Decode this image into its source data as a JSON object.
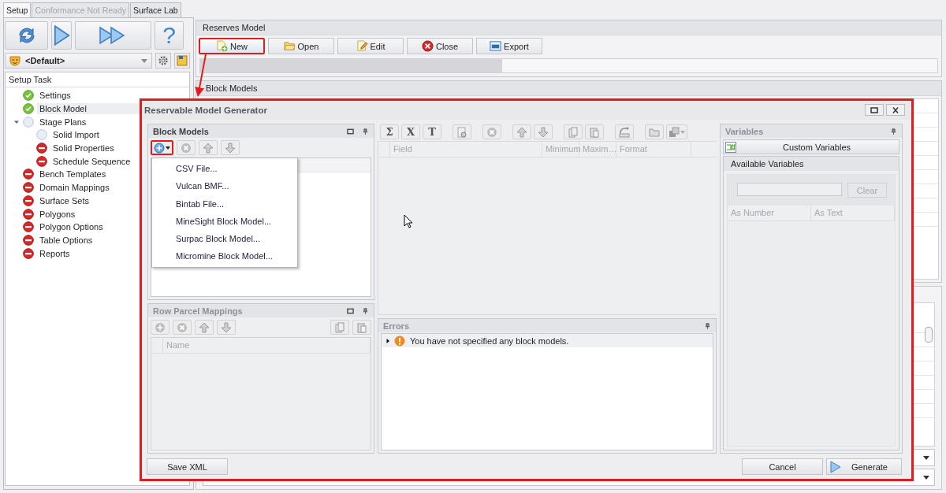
{
  "app_tabs": [
    {
      "label": "Setup",
      "selected": true,
      "disabled": false
    },
    {
      "label": "Conformance Not Ready",
      "selected": false,
      "disabled": true
    },
    {
      "label": "Surface Lab",
      "selected": false,
      "disabled": false
    }
  ],
  "profile": {
    "value": "<Default>"
  },
  "help_button": {
    "glyph": "?"
  },
  "setup_tree": {
    "header": "Setup Task",
    "items": [
      {
        "label": "Settings",
        "kind": "done",
        "selected": false
      },
      {
        "label": "Block Model",
        "kind": "done",
        "selected": true
      },
      {
        "label": "Stage Plans",
        "kind": "pending",
        "selected": false,
        "expanded": true,
        "children": [
          {
            "label": "Solid Import",
            "kind": "pending",
            "selected": false
          },
          {
            "label": "Solid Properties",
            "kind": "error",
            "selected": false
          },
          {
            "label": "Schedule Sequence",
            "kind": "error",
            "selected": false
          }
        ]
      },
      {
        "label": "Bench Templates",
        "kind": "error",
        "selected": false
      },
      {
        "label": "Domain Mappings",
        "kind": "error",
        "selected": false
      },
      {
        "label": "Surface Sets",
        "kind": "error",
        "selected": false
      },
      {
        "label": "Polygons",
        "kind": "error",
        "selected": false
      },
      {
        "label": "Polygon Options",
        "kind": "error",
        "selected": false
      },
      {
        "label": "Table Options",
        "kind": "error",
        "selected": false
      },
      {
        "label": "Reports",
        "kind": "error",
        "selected": false
      }
    ]
  },
  "reserves_model": {
    "title": "Reserves Model",
    "buttons": [
      {
        "kind": "new",
        "label": "New",
        "highlighted": true
      },
      {
        "kind": "open",
        "label": "Open",
        "highlighted": false
      },
      {
        "kind": "edit",
        "label": "Edit",
        "highlighted": false
      },
      {
        "kind": "close",
        "label": "Close",
        "highlighted": false
      },
      {
        "kind": "export",
        "label": "Export",
        "highlighted": false
      }
    ],
    "progress": {
      "level": 0.41
    }
  },
  "block_models_panel": {
    "title": "Block Models"
  },
  "dialog": {
    "title": "Reservable Model Generator",
    "highlighted": true,
    "block_models": {
      "title": "Block Models",
      "add_highlighted": true,
      "menu": [
        "CSV File...",
        "Vulcan BMF...",
        "Bintab File...",
        "MineSight Block Model...",
        "Surpac Block Model...",
        "Micromine Block Model..."
      ]
    },
    "row_parcel_mappings": {
      "title": "Row Parcel Mappings",
      "columns": [
        "Name"
      ]
    },
    "formula_buttons": [
      "Σ",
      "X",
      "T"
    ],
    "fields_grid": {
      "columns": [
        "Field",
        "Minimum",
        "Maxim…",
        "Format"
      ]
    },
    "errors": {
      "title": "Errors",
      "rows": [
        {
          "message": "You have not specified any block models.",
          "expanded": false
        }
      ]
    },
    "variables": {
      "title": "Variables",
      "custom_button": "Custom Variables",
      "available_title": "Available Variables",
      "clear_button": "Clear",
      "columns": [
        "As Number",
        "As Text"
      ]
    },
    "save_button": "Save XML",
    "cancel_button": "Cancel",
    "generate_button": "Generate"
  }
}
